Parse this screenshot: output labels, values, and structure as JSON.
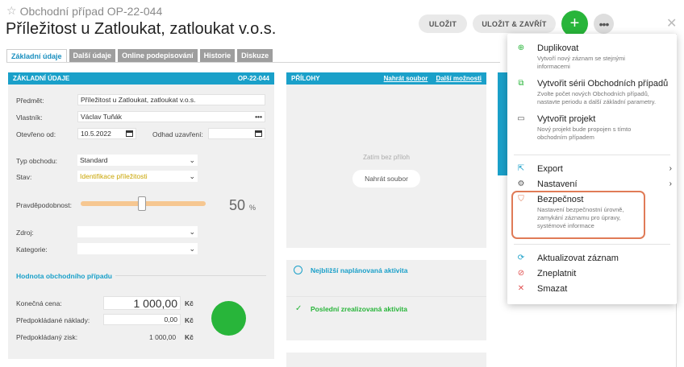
{
  "header": {
    "subtitle": "Obchodní případ OP-22-044",
    "title": "Příležitost u Zatloukat, zatloukat v.o.s.",
    "save_label": "ULOŽIT",
    "save_close_label": "ULOŽIT & ZAVŘÍT",
    "add_label": "+",
    "more_label": "•••",
    "close_label": "✕"
  },
  "tabs": [
    "Základní údaje",
    "Další údaje",
    "Online podepisování",
    "Historie",
    "Diskuze"
  ],
  "basic": {
    "header_title": "ZÁKLADNÍ ÚDAJE",
    "header_code": "OP-22-044",
    "subject_label": "Předmět:",
    "subject_value": "Příležitost u Zatloukat, zatloukat v.o.s.",
    "owner_label": "Vlastník:",
    "owner_value": "Václav Tuňák",
    "opened_label": "Otevřeno od:",
    "opened_value": "10.5.2022",
    "close_est_label": "Odhad uzavření:",
    "type_label": "Typ obchodu:",
    "type_value": "Standard",
    "state_label": "Stav:",
    "state_value": "Identifikace příležitosti",
    "probability_label": "Pravděpodobnost:",
    "probability_value": "50",
    "probability_unit": "%",
    "source_label": "Zdroj:",
    "category_label": "Kategorie:",
    "value_section_title": "Hodnota obchodního případu",
    "final_price_label": "Konečná cena:",
    "final_price_value": "1 000,00",
    "expected_costs_label": "Předpokládané náklady:",
    "expected_costs_value": "0,00",
    "expected_profit_label": "Předpokládaný zisk:",
    "expected_profit_value": "1 000,00",
    "currency": "Kč"
  },
  "attachments": {
    "header_title": "PŘÍLOHY",
    "upload_link": "Nahrát soubor",
    "more_link": "Další možnosti",
    "empty_text": "Zatím bez příloh",
    "upload_button": "Nahrát soubor"
  },
  "activities": {
    "next_planned": "Nejbližší naplánovaná aktivita",
    "last_done": "Poslední zrealizovaná aktivita"
  },
  "menu": {
    "items": [
      {
        "label": "Duplikovat",
        "desc": "Vytvoří nový záznam se stejnými informacemi"
      },
      {
        "label": "Vytvořit sérii Obchodních případů",
        "desc": "Zvolte počet nových Obchodních případů, nastavte periodu a další základní parametry."
      },
      {
        "label": "Vytvořit projekt",
        "desc": "Nový projekt bude propojen s tímto obchodním případem"
      },
      {
        "label": "Export",
        "arrow": "›"
      },
      {
        "label": "Nastavení",
        "arrow": "›"
      },
      {
        "label": "Bezpečnost",
        "desc": "Nastavení bezpečnostní úrovně, zamykání záznamu pro úpravy, systémové informace"
      },
      {
        "label": "Aktualizovat záznam"
      },
      {
        "label": "Zneplatnit"
      },
      {
        "label": "Smazat"
      }
    ]
  },
  "colors": {
    "accent": "#1aa0c9",
    "green": "#28b53a",
    "highlight": "#e07b57",
    "state_text": "#c9a400"
  }
}
